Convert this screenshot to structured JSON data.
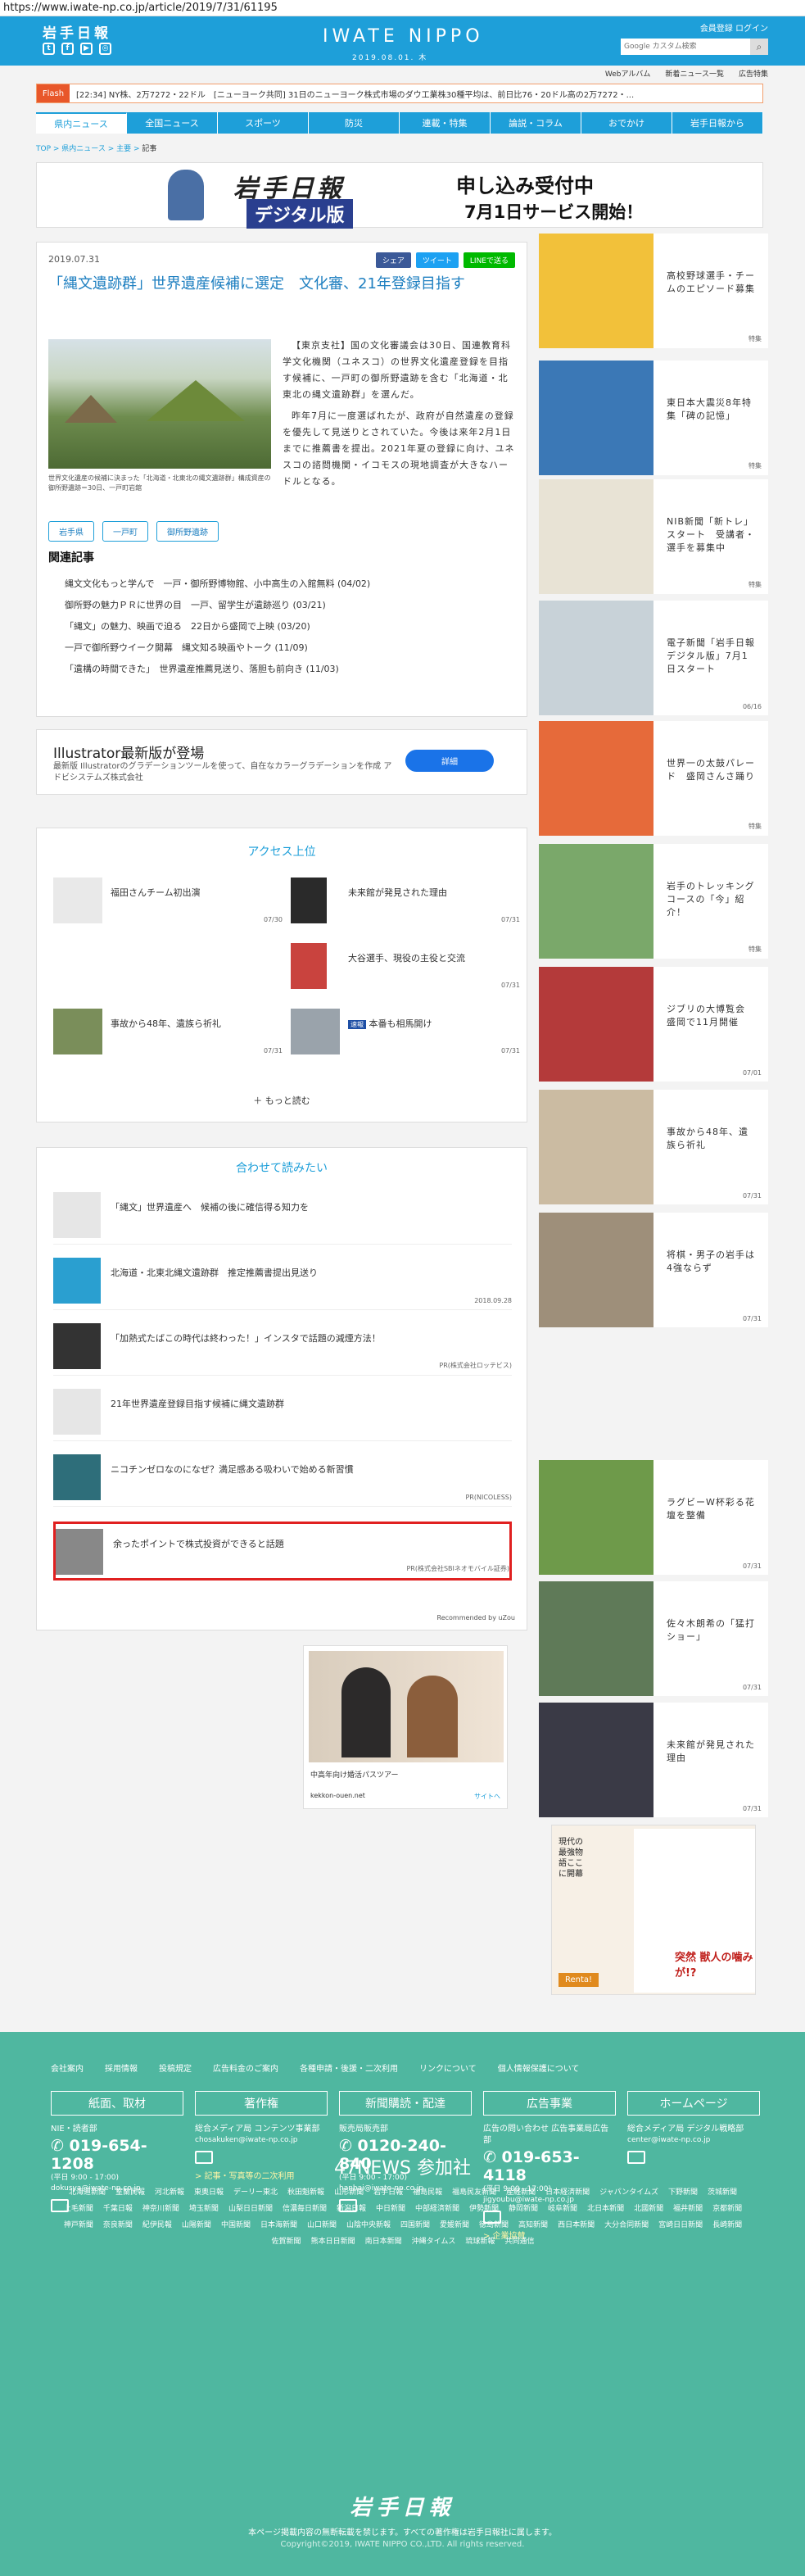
{
  "url": "https://www.iwate-np.co.jp/article/2019/7/31/61195",
  "header": {
    "logo": "岩手日報",
    "brand": "IWATE NIPPO",
    "date": "2019.08.01. 木",
    "member_links": "会員登録 ログイン",
    "search_placeholder": "Google カスタム検索",
    "subnav": [
      "Webアルバム",
      "新着ニュース一覧",
      "広告特集"
    ]
  },
  "flash": {
    "tag": "Flash",
    "text": "[22:34] NY株、2万7272・22ドル　[ニューヨーク共同] 31日のニューヨーク株式市場のダウ工業株30種平均は、前日比76・20ドル高の2万7272・..."
  },
  "mainnav": [
    "県内ニュース",
    "全国ニュース",
    "スポーツ",
    "防災",
    "連載・特集",
    "論説・コラム",
    "おでかけ",
    "岩手日報から"
  ],
  "breadcrumb": {
    "top": "TOP",
    "cat": "県内ニュース",
    "sub": "主要",
    "current": "記事"
  },
  "banner": {
    "title": "岩手日報",
    "sub": "デジタル版",
    "headline": "申し込み受付中",
    "service": "7月1日サービス開始！"
  },
  "article": {
    "date": "2019.07.31",
    "share": [
      "シェア",
      "ツイート",
      "LINEで送る"
    ],
    "title": "「縄文遺跡群」世界遺産候補に選定　文化審、21年登録目指す",
    "caption": "世界文化遺産の候補に決まった「北海道・北東北の縄文遺跡群」構成資産の御所野遺跡＝30日、一戸町岩舘",
    "body1": "【東京支社】国の文化審議会は30日、国連教育科学文化機関（ユネスコ）の世界文化遺産登録を目指す候補に、一戸町の御所野遺跡を含む「北海道・北東北の縄文遺跡群」を選んだ。",
    "body2": "昨年7月に一度選ばれたが、政府が自然遺産の登録を優先して見送りとされていた。今後は来年2月1日までに推薦書を提出。2021年夏の登録に向け、ユネスコの諮問機関・イコモスの現地調査が大きなハードルとなる。",
    "tags": [
      "岩手県",
      "一戸町",
      "御所野遺跡"
    ],
    "related_title": "関連記事",
    "related": [
      "縄文文化もっと学んで　一戸・御所野博物館、小中高生の入館無料 (04/02)",
      "御所野の魅力ＰＲに世界の目　一戸、留学生が遺跡巡り (03/21)",
      "「縄文」の魅力、映画で迫る　22日から盛岡で上映 (03/20)",
      "一戸で御所野ウイーク開幕　縄文知る映画やトーク (11/09)",
      "「遺構の時間できた」　世界遺産推薦見送り、落胆も前向き (11/03)"
    ]
  },
  "ad_illustrator": {
    "title": "Illustrator最新版が登場",
    "desc": "最新版 Illustratorのグラデーションツールを使って、自在なカラーグラデーションを作成 アドビシステムズ株式会社",
    "button": "詳細"
  },
  "ranking": {
    "title": "アクセス上位",
    "items": [
      {
        "title": "福田さんチーム初出演",
        "date": "07/30"
      },
      {
        "title": "未来館が発見された理由",
        "date": "07/31"
      },
      {
        "title": "大谷選手、現役の主役と交流",
        "date": "07/31"
      },
      {
        "title": "事故から48年、遺族ら祈礼",
        "date": "07/31"
      },
      {
        "title": "本番も相馬開け",
        "date": "07/31",
        "badge": "速報"
      }
    ],
    "more": "もっと読む"
  },
  "together": {
    "title": "合わせて読みたい",
    "items": [
      {
        "title": "「縄文」世界遺産へ　候補の後に確信得る知力を",
        "meta": ""
      },
      {
        "title": "北海道・北東北縄文遺跡群　推定推薦書提出見送り",
        "meta": "2018.09.28"
      },
      {
        "title": "「加熱式たばこの時代は終わった！」インスタで話題の減煙方法！",
        "meta": "PR(株式会社ロッテビス)"
      },
      {
        "title": "21年世界遺産登録目指す候補に縄文遺跡群",
        "meta": ""
      },
      {
        "title": "ニコチンゼロなのになぜ？満足感ある吸わいで始める新習慣",
        "meta": "PR(NICOLESS)"
      },
      {
        "title": "余ったポイントで株式投資ができると話題",
        "meta": "PR(株式会社SBIネオモバイル証券)"
      }
    ],
    "recommended": "Recommended by uZou"
  },
  "ad_bottom": {
    "caption": "中高年向け婚活パスツアー",
    "site": "kekkon-ouen.net",
    "link": "サイトへ"
  },
  "sidebar": [
    {
      "title": "高校野球選手・チームのエピソード募集",
      "tag": "特集",
      "color": "#f2c13a"
    },
    {
      "title": "東日本大震災8年特集「碑の記憶」",
      "tag": "特集",
      "color": "#3b78b6"
    },
    {
      "title": "NIB新聞「新トレ」スタート　受講者・選手を募集中",
      "tag": "特集",
      "color": "#e8e3d5"
    },
    {
      "title": "電子新聞「岩手日報デジタル版」7月1日スタート",
      "tag": "06/16",
      "color": "#c8d2d8"
    },
    {
      "title": "世界一の太鼓パレード　盛岡さんさ踊り",
      "tag": "特集",
      "color": "#e66a3a"
    },
    {
      "title": "岩手のトレッキングコースの「今」紹介！",
      "tag": "特集",
      "color": "#7aa86a"
    },
    {
      "title": "ジブリの大博覧会　盛岡で11月開催",
      "tag": "07/01",
      "color": "#b43a3a"
    },
    {
      "title": "事故から48年、遺族ら祈礼",
      "tag": "07/31",
      "color": "#cbbba2"
    },
    {
      "title": "将棋・男子の岩手は4強ならず",
      "tag": "07/31",
      "color": "#9e8f7a"
    },
    {
      "title": "ラグビーW杯彩る花壇を整備",
      "tag": "07/31",
      "color": "#6e9a4a"
    },
    {
      "title": "佐々木朗希の「猛打ショー」",
      "tag": "07/31",
      "color": "#5f7a58"
    },
    {
      "title": "未来館が発見された理由",
      "tag": "07/31",
      "color": "#3a3a46"
    }
  ],
  "side_ad": {
    "vertical": "現代の最強物語ここに開幕",
    "title": "突然 獣人の噛みが!?",
    "brand": "Renta!"
  },
  "footer": {
    "links": [
      "会社案内",
      "採用情報",
      "投稿規定",
      "広告料金のご案内",
      "各種申請・後援・二次利用",
      "リンクについて",
      "個人情報保護について"
    ],
    "cols": [
      {
        "head": "紙面、取材",
        "label": "NIE・読者部",
        "tel": "019-654-1208",
        "hours": "(平日 9:00 - 17:00)",
        "mail": "dokusya@iwate-np.co.jp",
        "extra": ""
      },
      {
        "head": "著作権",
        "label": "総合メディア局 コンテンツ事業部",
        "tel": "",
        "hours": "",
        "mail": "chosakuken@iwate-np.co.jp",
        "extra": "> 記事・写真等の二次利用"
      },
      {
        "head": "新聞購読・配達",
        "label": "販売局販売部",
        "tel": "0120-240-840",
        "hours": "(平日 9:00 - 17:00)",
        "mail": "hanbai@iwate-np.co.jp",
        "extra": ""
      },
      {
        "head": "広告事業",
        "label": "広告の問い合わせ 広告事業局広告部",
        "tel": "019-653-4118",
        "hours": "(平日 9:00 - 17:00)",
        "mail": "jigyoubu@iwate-np.co.jp",
        "extra": "> 企業協賛"
      },
      {
        "head": "ホームページ",
        "label": "総合メディア局 デジタル戦略部",
        "tel": "",
        "hours": "",
        "mail": "center@iwate-np.co.jp",
        "extra": ""
      }
    ],
    "f47": "47NEWS 参加社",
    "papers": [
      "北海道新聞",
      "室蘭民報",
      "河北新報",
      "東奥日報",
      "デーリー東北",
      "秋田魁新報",
      "山形新聞",
      "岩手日報",
      "福島民報",
      "福島民友新聞",
      "産経新聞",
      "日本経済新聞",
      "ジャパンタイムズ",
      "下野新聞",
      "茨城新聞",
      "上毛新聞",
      "千葉日報",
      "神奈川新聞",
      "埼玉新聞",
      "山梨日日新聞",
      "信濃毎日新聞",
      "新潟日報",
      "中日新聞",
      "中部経済新聞",
      "伊勢新聞",
      "静岡新聞",
      "岐阜新聞",
      "北日本新聞",
      "北國新聞",
      "福井新聞",
      "京都新聞",
      "神戸新聞",
      "奈良新聞",
      "紀伊民報",
      "山陽新聞",
      "中国新聞",
      "日本海新聞",
      "山口新聞",
      "山陰中央新報",
      "四国新聞",
      "愛媛新聞",
      "徳島新聞",
      "高知新聞",
      "西日本新聞",
      "大分合同新聞",
      "宮崎日日新聞",
      "長崎新聞",
      "佐賀新聞",
      "熊本日日新聞",
      "南日本新聞",
      "沖縄タイムス",
      "琉球新報",
      "共同通信"
    ],
    "logo": "岩手日報",
    "copy1": "本ページ掲載内容の無断転載を禁じます。すべての著作権は岩手日報社に属します。",
    "copy2": "Copyright©2019, IWATE NIPPO CO.,LTD. All rights reserved."
  }
}
